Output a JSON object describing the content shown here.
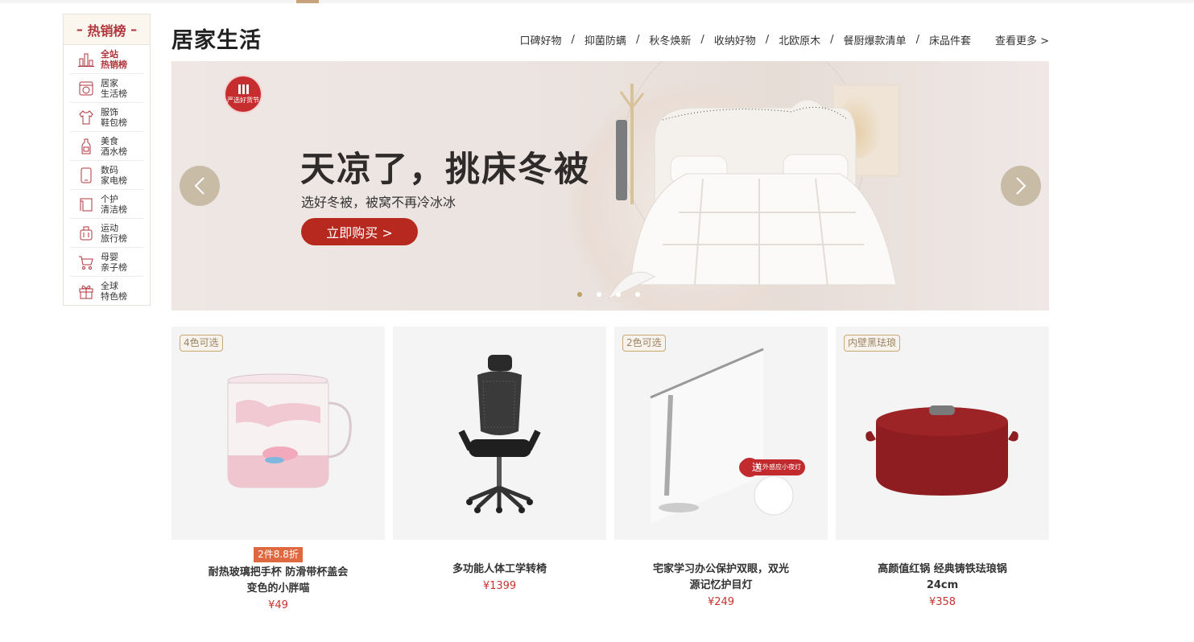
{
  "sidebar": {
    "title": "热销榜",
    "items": [
      {
        "line1": "全站",
        "line2": "热销榜",
        "icon": "bar-chart-icon",
        "active": true
      },
      {
        "line1": "居家",
        "line2": "生活榜",
        "icon": "washing-machine-icon",
        "active": false
      },
      {
        "line1": "服饰",
        "line2": "鞋包榜",
        "icon": "shirt-icon",
        "active": false
      },
      {
        "line1": "美食",
        "line2": "酒水榜",
        "icon": "bottle-icon",
        "active": false
      },
      {
        "line1": "数码",
        "line2": "家电榜",
        "icon": "phone-icon",
        "active": false
      },
      {
        "line1": "个护",
        "line2": "清洁榜",
        "icon": "towel-icon",
        "active": false
      },
      {
        "line1": "运动",
        "line2": "旅行榜",
        "icon": "suitcase-icon",
        "active": false
      },
      {
        "line1": "母婴",
        "line2": "亲子榜",
        "icon": "cart-icon",
        "active": false
      },
      {
        "line1": "全球",
        "line2": "特色榜",
        "icon": "gift-icon",
        "active": false
      }
    ]
  },
  "header": {
    "title": "居家生活",
    "nav": [
      "口碑好物",
      "抑菌防螨",
      "秋冬焕新",
      "收纳好物",
      "北欧原木",
      "餐厨爆款清单",
      "床品件套"
    ],
    "separator": "/",
    "more": "查看更多 >"
  },
  "banner": {
    "badge_text": "严选好货节",
    "title": "天凉了，挑床冬被",
    "subtitle": "选好冬被，被窝不再冷冰冰",
    "cta": "立即购买 >",
    "dots": 4,
    "active_dot": 0
  },
  "products": [
    {
      "tag": "4色可选",
      "promo": "2件8.8折",
      "name": "耐热玻璃把手杯 防滑带杯盖会变色的小胖喵",
      "price": "¥49",
      "icon": "glass-mug-icon"
    },
    {
      "tag": "",
      "promo": "",
      "name": "多功能人体工学转椅",
      "price": "¥1399",
      "icon": "office-chair-icon"
    },
    {
      "tag": "2色可选",
      "promo": "",
      "name": "宅家学习办公保护双眼，双光源记忆护目灯",
      "price": "¥249",
      "icon": "desk-lamp-icon",
      "gift_badge": "送",
      "gift_text": "红外感应小夜灯"
    },
    {
      "tag": "内壁黑珐琅",
      "promo": "",
      "name": "高颜值红锅 经典铸铁珐琅锅24cm",
      "price": "¥358",
      "icon": "cast-iron-pot-icon"
    }
  ],
  "colors": {
    "accent": "#b1353c",
    "price": "#c8332f",
    "cta": "#b7291f",
    "promo": "#e0683f"
  }
}
